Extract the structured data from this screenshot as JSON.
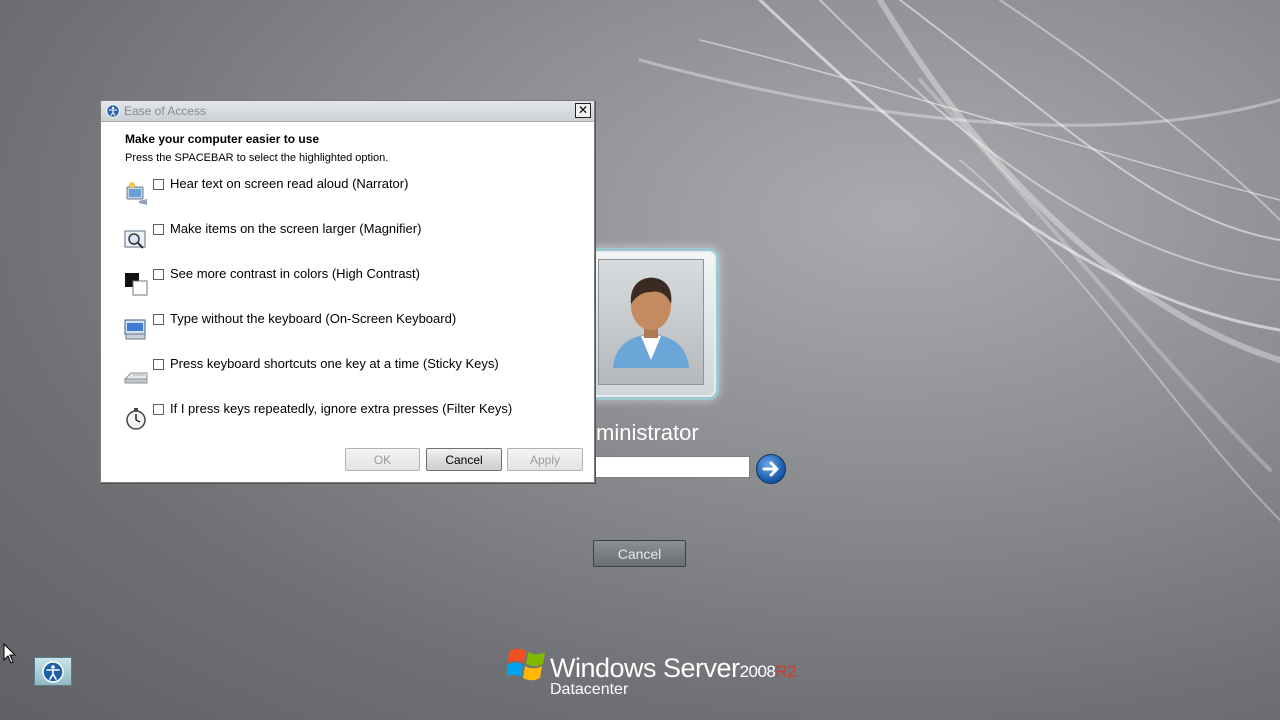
{
  "dialog": {
    "title": "Ease of Access",
    "close_label": "✕",
    "heading": "Make your computer easier to use",
    "instructions": "Press the SPACEBAR to select the highlighted option.",
    "options": [
      {
        "label": "Hear text on screen read aloud (Narrator)",
        "icon": "narrator-icon",
        "checked": false
      },
      {
        "label": "Make items on the screen larger (Magnifier)",
        "icon": "magnifier-icon",
        "checked": false
      },
      {
        "label": "See more contrast in colors (High Contrast)",
        "icon": "high-contrast-icon",
        "checked": false
      },
      {
        "label": "Type without the keyboard (On-Screen Keyboard)",
        "icon": "on-screen-keyboard-icon",
        "checked": false
      },
      {
        "label": "Press keyboard shortcuts one key at a time (Sticky Keys)",
        "icon": "sticky-keys-icon",
        "checked": false
      },
      {
        "label": "If I press keys repeatedly, ignore extra presses (Filter Keys)",
        "icon": "filter-keys-icon",
        "checked": false
      }
    ],
    "buttons": {
      "ok": "OK",
      "cancel": "Cancel",
      "apply": "Apply"
    }
  },
  "login": {
    "username": "ministrator",
    "password_value": "",
    "cancel_label": "Cancel"
  },
  "branding": {
    "product": "Windows Server",
    "version": "2008",
    "release": "R2",
    "edition": "Datacenter"
  },
  "colors": {
    "arrow_button": "#1d5fb0",
    "r2_red": "#d33a2c",
    "dialog_bg": "#ffffff"
  }
}
